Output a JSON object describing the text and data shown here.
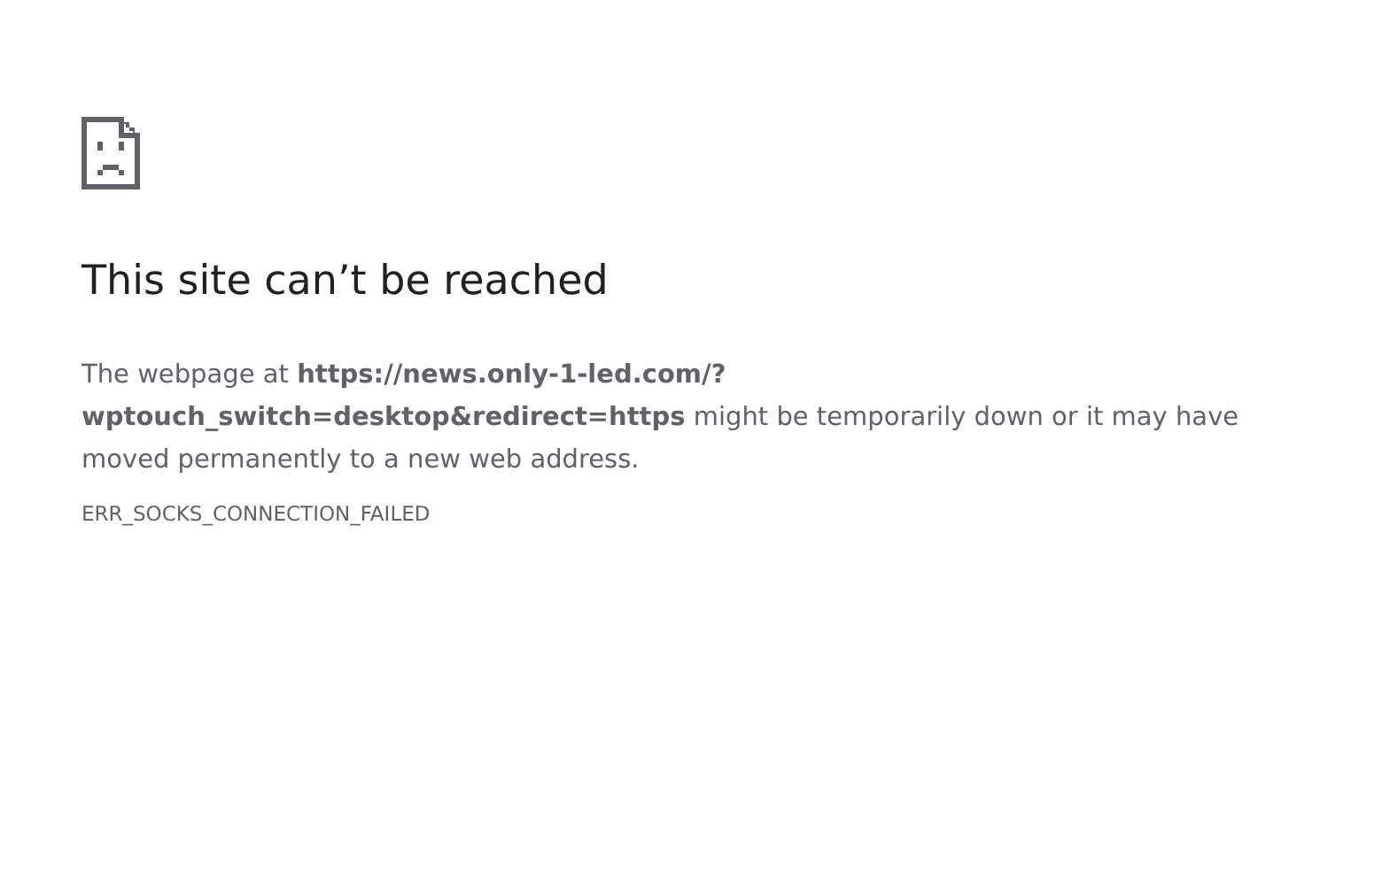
{
  "heading": "This site can’t be reached",
  "message": "The webpage at **https://news.only-1-led.com/?wptouch_switch=desktop&redirect=https** might be temporarily down or it may have moved permanently to a new web address.",
  "error_code": "ERR_SOCKS_CONNECTION_FAILED"
}
